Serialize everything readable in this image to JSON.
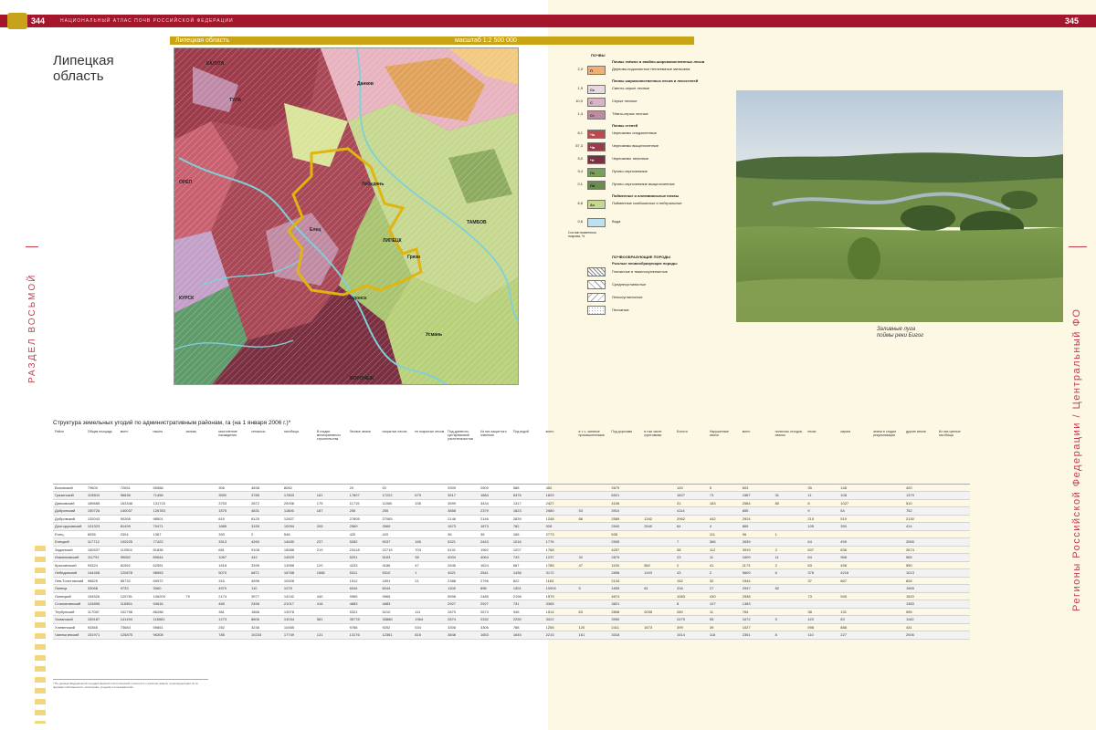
{
  "header": {
    "page_left": "344",
    "title": "НАЦИОНАЛЬНЫЙ АТЛАС ПОЧВ РОССИЙСКОЙ ФЕДЕРАЦИИ",
    "page_right": "345"
  },
  "map_strip": {
    "region": "Липецкая область",
    "scale": "масштаб 1:2 500 000"
  },
  "region_title": "Липецкая область",
  "map_labels": [
    "КАЛУГА",
    "ТУЛА",
    "ОРЁЛ",
    "КУРСК",
    "ЛИПЕЦК",
    "ВОРОНЕЖ",
    "ТАМБОВ",
    "Елец",
    "Данков",
    "Грязи",
    "Лебедянь",
    "Задонск",
    "Усмань"
  ],
  "legend": {
    "head": "ПОЧВЫ",
    "group1": "Почвы таёжно и хвойно-широколиственных лесов",
    "group2": "Почвы широколиственных лесов и лесостепей",
    "group3": "Почвы степей",
    "group4": "Пойменные и аллювиальные почвы",
    "rows": [
      {
        "pct": "2,3",
        "code": "П",
        "label": "Дерново-подзолистые неглееватые мелкозем.",
        "color": "#f2b070"
      },
      {
        "pct": "1,9",
        "code": "Сс",
        "label": "Светло-серые лесные",
        "color": "#e8d8e0"
      },
      {
        "pct": "10,0",
        "code": "С",
        "label": "Серые лесные",
        "color": "#d9b4c4"
      },
      {
        "pct": "1,4",
        "code": "Ст",
        "label": "Тёмно-серые лесные",
        "color": "#c08aa3"
      },
      {
        "pct": "6,1",
        "code": "Чо",
        "label": "Черноземы оподзоленные",
        "color": "#b84a52"
      },
      {
        "pct": "57,3",
        "code": "Чв",
        "label": "Черноземы выщелоченные",
        "color": "#9c3b4a"
      },
      {
        "pct": "5,0",
        "code": "Чт",
        "label": "Черноземы типичные",
        "color": "#7a3040"
      },
      {
        "pct": "9,4",
        "code": "Лч",
        "label": "Лугово-черноземные",
        "color": "#78a058"
      },
      {
        "pct": "0,1",
        "code": "Лв",
        "label": "Лугово-черноземные выщелоченные",
        "color": "#6a8c50"
      },
      {
        "pct": "6,8",
        "code": "Аз",
        "label": "Пойменные слабокислые и нейтральные",
        "color": "#c6d890"
      },
      {
        "pct": "0,6",
        "code": "",
        "label": "Вода",
        "color": "#bfe0ee"
      }
    ],
    "note": "Состав почвенного покрова, %",
    "rocks_head": "ПОЧВООБРАЗУЮЩИЕ ПОРОДЫ",
    "rocks_sub": "Рыхлые почвообразующие породы",
    "patterns": [
      "Глинистые и тяжелосуглинистые",
      "Среднесуглинистые",
      "Легкосуглинистые",
      "Песчаные"
    ]
  },
  "photo_caption": {
    "line1": "Заливные луга",
    "line2": "поймы реки Бигог"
  },
  "side_left": "РАЗДЕЛ ВОСЬМОЙ",
  "side_right": "Регионы Российской Федерации / Центральный ФО",
  "table": {
    "title": "Структура земельных угодий по административным районам, га (на 1 января 2006 г.)*",
    "headers": [
      "Район",
      "Общая площадь",
      "всего",
      "пашня",
      "залежь",
      "многолетние насаждения",
      "сенокосы",
      "пастбища",
      "В стадии мелиоративного строительства",
      "Лесные земли",
      "покрытые лесом",
      "не покрытые лесом",
      "Под древесно-кустарниковой растительностью",
      "Из них защитного значения",
      "Под водой",
      "всего",
      "в т. ч. занятые промышленными",
      "Под дорогами",
      "в том числе грунтовыми",
      "Болота",
      "Нарушенные земли",
      "всего",
      "полигоны отходов, свалки",
      "пески",
      "овраги",
      "земли в стадии рекультивации",
      "другие земли",
      "Из них ценные пастбища"
    ],
    "rows": [
      [
        "Воловский",
        "79600",
        "72651",
        "55588",
        "",
        "306",
        "4838",
        "8082",
        "",
        "20",
        "20",
        "",
        "2509",
        "2509",
        "588",
        "452",
        "",
        "2679",
        "",
        "145",
        "5",
        "603",
        "",
        "35",
        "148",
        "",
        "420",
        ""
      ],
      [
        "Грязинский",
        "115504",
        "96636",
        "71456",
        "",
        "3592",
        "3785",
        "17803",
        "161",
        "17807",
        "17222",
        "675",
        "3517",
        "1884",
        "6376",
        "1829",
        "",
        "6521",
        "",
        "1827",
        "73",
        "1587",
        "31",
        "11",
        "108",
        "",
        "1379",
        ""
      ],
      [
        "Данковский",
        "189685",
        "163348",
        "131715",
        "",
        "3753",
        "2872",
        "25008",
        "175",
        "11715",
        "11560",
        "155",
        "3599",
        "3434",
        "1317",
        "2427",
        "",
        "4106",
        "",
        "31",
        "183",
        "2584",
        "80",
        "8",
        "1027",
        "",
        "510",
        ""
      ],
      [
        "Добринский",
        "150726",
        "140037",
        "126783",
        "",
        "1575",
        "4831",
        "11806",
        "187",
        "255",
        "255",
        "",
        "3858",
        "2379",
        "1823",
        "2580",
        "53",
        "3910",
        "",
        "4114",
        "",
        "855",
        "",
        "9",
        "54",
        "",
        "752",
        ""
      ],
      [
        "Добровский",
        "132043",
        "90268",
        "98501",
        "",
        "815",
        "8125",
        "12827",
        "",
        "27805",
        "27065",
        "",
        "2146",
        "2146",
        "2839",
        "1248",
        "86",
        "2589",
        "1342",
        "2962",
        "442",
        "2924",
        "",
        "215",
        "519",
        "",
        "2130",
        ""
      ],
      [
        "Долгоруковский",
        "101323",
        "81499",
        "70471",
        "",
        "1685",
        "3159",
        "10094",
        "205",
        "2569",
        "2569",
        "",
        "1873",
        "1873",
        "782",
        "928",
        "",
        "2540",
        "2540",
        "64",
        "4",
        "869",
        "",
        "105",
        "350",
        "",
        "414",
        ""
      ],
      [
        "Елец",
        "6535",
        "2304",
        "1367",
        "",
        "393",
        "2",
        "548",
        "",
        "420",
        "420",
        "",
        "36",
        "36",
        "165",
        "2773",
        "",
        "535",
        "",
        "",
        "111",
        "96",
        "1",
        "",
        "",
        "",
        "",
        ""
      ],
      [
        "Елецкий",
        "117712",
        "100225",
        "77422",
        "",
        "3913",
        "4260",
        "14630",
        "237",
        "5282",
        "5037",
        "165",
        "5321",
        "2443",
        "1016",
        "1776",
        "",
        "2905",
        "",
        "7",
        "366",
        "2639",
        "",
        "64",
        "499",
        "",
        "2065",
        ""
      ],
      [
        "Задонский",
        "150537",
        "110504",
        "81836",
        "",
        "681",
        "9108",
        "18588",
        "219",
        "23418",
        "22715",
        "703",
        "5101",
        "1962",
        "1207",
        "1768",
        "",
        "4257",
        "",
        "38",
        "112",
        "3919",
        "2",
        "607",
        "636",
        "",
        "2674",
        ""
      ],
      [
        "Измалковский",
        "111791",
        "99082",
        "80644",
        "",
        "1067",
        "442",
        "14529",
        "",
        "5201",
        "5163",
        "38",
        "4004",
        "4064",
        "743",
        "1237",
        "32",
        "2875",
        "",
        "23",
        "11",
        "1609",
        "11",
        "64",
        "968",
        "",
        "565",
        ""
      ],
      [
        "Краснинский",
        "93324",
        "81552",
        "62551",
        "",
        "1618",
        "3395",
        "13958",
        "120",
        "4233",
        "4186",
        "47",
        "2645",
        "1624",
        "667",
        "1785",
        "47",
        "1150",
        "582",
        "2",
        "41",
        "1173",
        "2",
        "83",
        "498",
        "",
        "590",
        ""
      ],
      [
        "Лебедянский",
        "144406",
        "120878",
        "98963",
        "",
        "5070",
        "6871",
        "18768",
        "1566",
        "5311",
        "5310",
        "1",
        "4521",
        "2541",
        "1436",
        "3172",
        "",
        "2898",
        "1193",
        "43",
        "2",
        "5609",
        "6",
        "376",
        "4216",
        "",
        "1013",
        ""
      ],
      [
        "Лев-Толстовский",
        "96825",
        "85732",
        "69972",
        "",
        "316",
        "4596",
        "10928",
        "",
        "1912",
        "1891",
        "21",
        "2388",
        "2796",
        "822",
        "1163",
        "",
        "2134",
        "",
        "152",
        "32",
        "1544",
        "",
        "37",
        "667",
        "",
        "826",
        ""
      ],
      [
        "Липецк",
        "33068",
        "9733",
        "3060",
        "",
        "4570",
        "110",
        "1075",
        "",
        "6044",
        "6044",
        "",
        "1108",
        "898",
        "1301",
        "10904",
        "5",
        "1839",
        "81",
        "316",
        "27",
        "2947",
        "82",
        "",
        "",
        "",
        "1965",
        ""
      ],
      [
        "Липецкий",
        "154526",
        "125781",
        "106209",
        "79",
        "2174",
        "3977",
        "14242",
        "440",
        "9965",
        "9965",
        "",
        "5598",
        "2485",
        "2198",
        "1579",
        "",
        "4674",
        "",
        "1083",
        "430",
        "2538",
        "",
        "73",
        "945",
        "",
        "1520",
        ""
      ],
      [
        "Становлянский",
        "124895",
        "116554",
        "94616",
        "",
        "465",
        "2456",
        "21017",
        "416",
        "4883",
        "4883",
        "",
        "2927",
        "2927",
        "731",
        "3365",
        "",
        "3821",
        "",
        "8",
        "107",
        "1383",
        "",
        "",
        "",
        "",
        "1383",
        ""
      ],
      [
        "Тербунский",
        "117087",
        "102798",
        "86288",
        "",
        "381",
        "1868",
        "13978",
        "",
        "5321",
        "5210",
        "111",
        "2873",
        "2673",
        "945",
        "1514",
        "63",
        "2808",
        "2035",
        "280",
        "11",
        "764",
        "",
        "38",
        "131",
        "",
        "595",
        ""
      ],
      [
        "Усманский",
        "159187",
        "141494",
        "118581",
        "",
        "1273",
        "8606",
        "13034",
        "581",
        "35778",
        "33886",
        "1964",
        "2874",
        "2332",
        "2290",
        "3022",
        "",
        "3950",
        "",
        "2479",
        "55",
        "1672",
        "5",
        "422",
        "83",
        "",
        "1162",
        ""
      ],
      [
        "Хлевенский",
        "93365",
        "73684",
        "59851",
        "",
        "252",
        "3236",
        "10465",
        "",
        "9786",
        "9252",
        "534",
        "3306",
        "3306",
        "788",
        "1255",
        "120",
        "2411",
        "1673",
        "399",
        "39",
        "1027",
        "",
        "598",
        "888",
        "",
        "431",
        ""
      ],
      [
        "Чаплыгинский",
        "151971",
        "125875",
        "96308",
        "",
        "785",
        "10233",
        "17749",
        "131",
        "13176",
        "12361",
        "815",
        "3848",
        "1653",
        "1645",
        "2215",
        "161",
        "3318",
        "",
        "1514",
        "118",
        "2351",
        "8",
        "110",
        "227",
        "",
        "2006",
        ""
      ]
    ]
  },
  "footnote": "* По данным Федеральной государственной статистической отчётности о наличии земель и распределении их по формам собственности, категориям, угодьям и пользователям"
}
